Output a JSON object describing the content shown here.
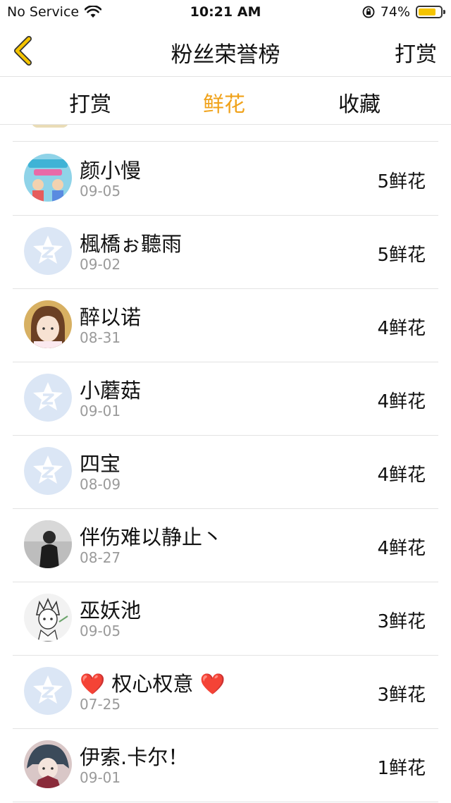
{
  "status_bar": {
    "carrier": "No Service",
    "time": "10:21 AM",
    "battery": "74%"
  },
  "header": {
    "title": "粉丝荣誉榜",
    "right_action": "打赏"
  },
  "tabs": [
    {
      "label": "打赏"
    },
    {
      "label": "鲜花"
    },
    {
      "label": "收藏"
    }
  ],
  "active_tab": "鲜花",
  "colors": {
    "accent": "#f0a21a",
    "battery": "#f5c400",
    "default_avatar": "#dbe6f5"
  },
  "fans": [
    {
      "name": "颜小慢",
      "date": "09-05",
      "amount": "5鲜花",
      "avatar": "book-cover-avatar"
    },
    {
      "name": "楓橋ぉ聽雨",
      "date": "09-02",
      "amount": "5鲜花",
      "avatar": "default-avatar"
    },
    {
      "name": "醉以诺",
      "date": "08-31",
      "amount": "4鲜花",
      "avatar": "girl-photo-avatar"
    },
    {
      "name": "小蘑菇",
      "date": "09-01",
      "amount": "4鲜花",
      "avatar": "default-avatar"
    },
    {
      "name": "四宝",
      "date": "08-09",
      "amount": "4鲜花",
      "avatar": "default-avatar"
    },
    {
      "name": "伴伤难以静止丶",
      "date": "08-27",
      "amount": "4鲜花",
      "avatar": "bw-photo-avatar"
    },
    {
      "name": "巫妖池",
      "date": "09-05",
      "amount": "3鲜花",
      "avatar": "sketch-avatar"
    },
    {
      "name": "❤️ 权心权意 ❤️",
      "date": "07-25",
      "amount": "3鲜花",
      "avatar": "default-avatar"
    },
    {
      "name": "伊索.卡尔！",
      "date": "09-01",
      "amount": "1鲜花",
      "avatar": "anime-avatar"
    }
  ]
}
